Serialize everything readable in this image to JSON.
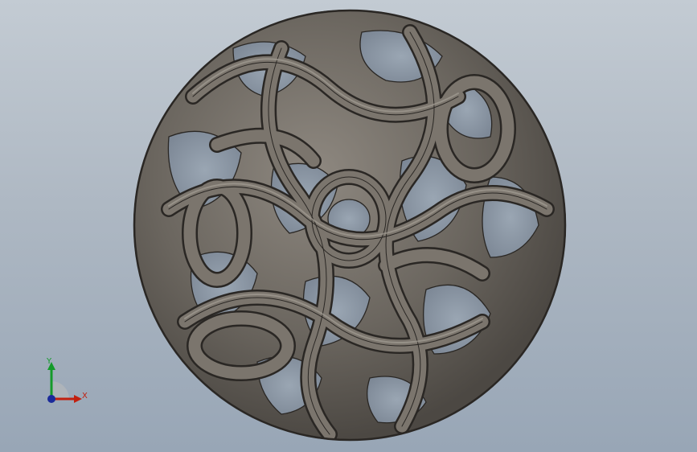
{
  "viewport": {
    "background_top": "#c3cbd3",
    "background_bottom": "#98a6b6"
  },
  "model": {
    "name": "lattice-sphere",
    "body_color": "#6f6a64",
    "edge_color": "#2a2724",
    "highlight_color": "#a09a92"
  },
  "triad": {
    "x_label": "X",
    "y_label": "Y",
    "x_color": "#c2200f",
    "y_color": "#149a2a",
    "z_color": "#1a2a9a"
  }
}
